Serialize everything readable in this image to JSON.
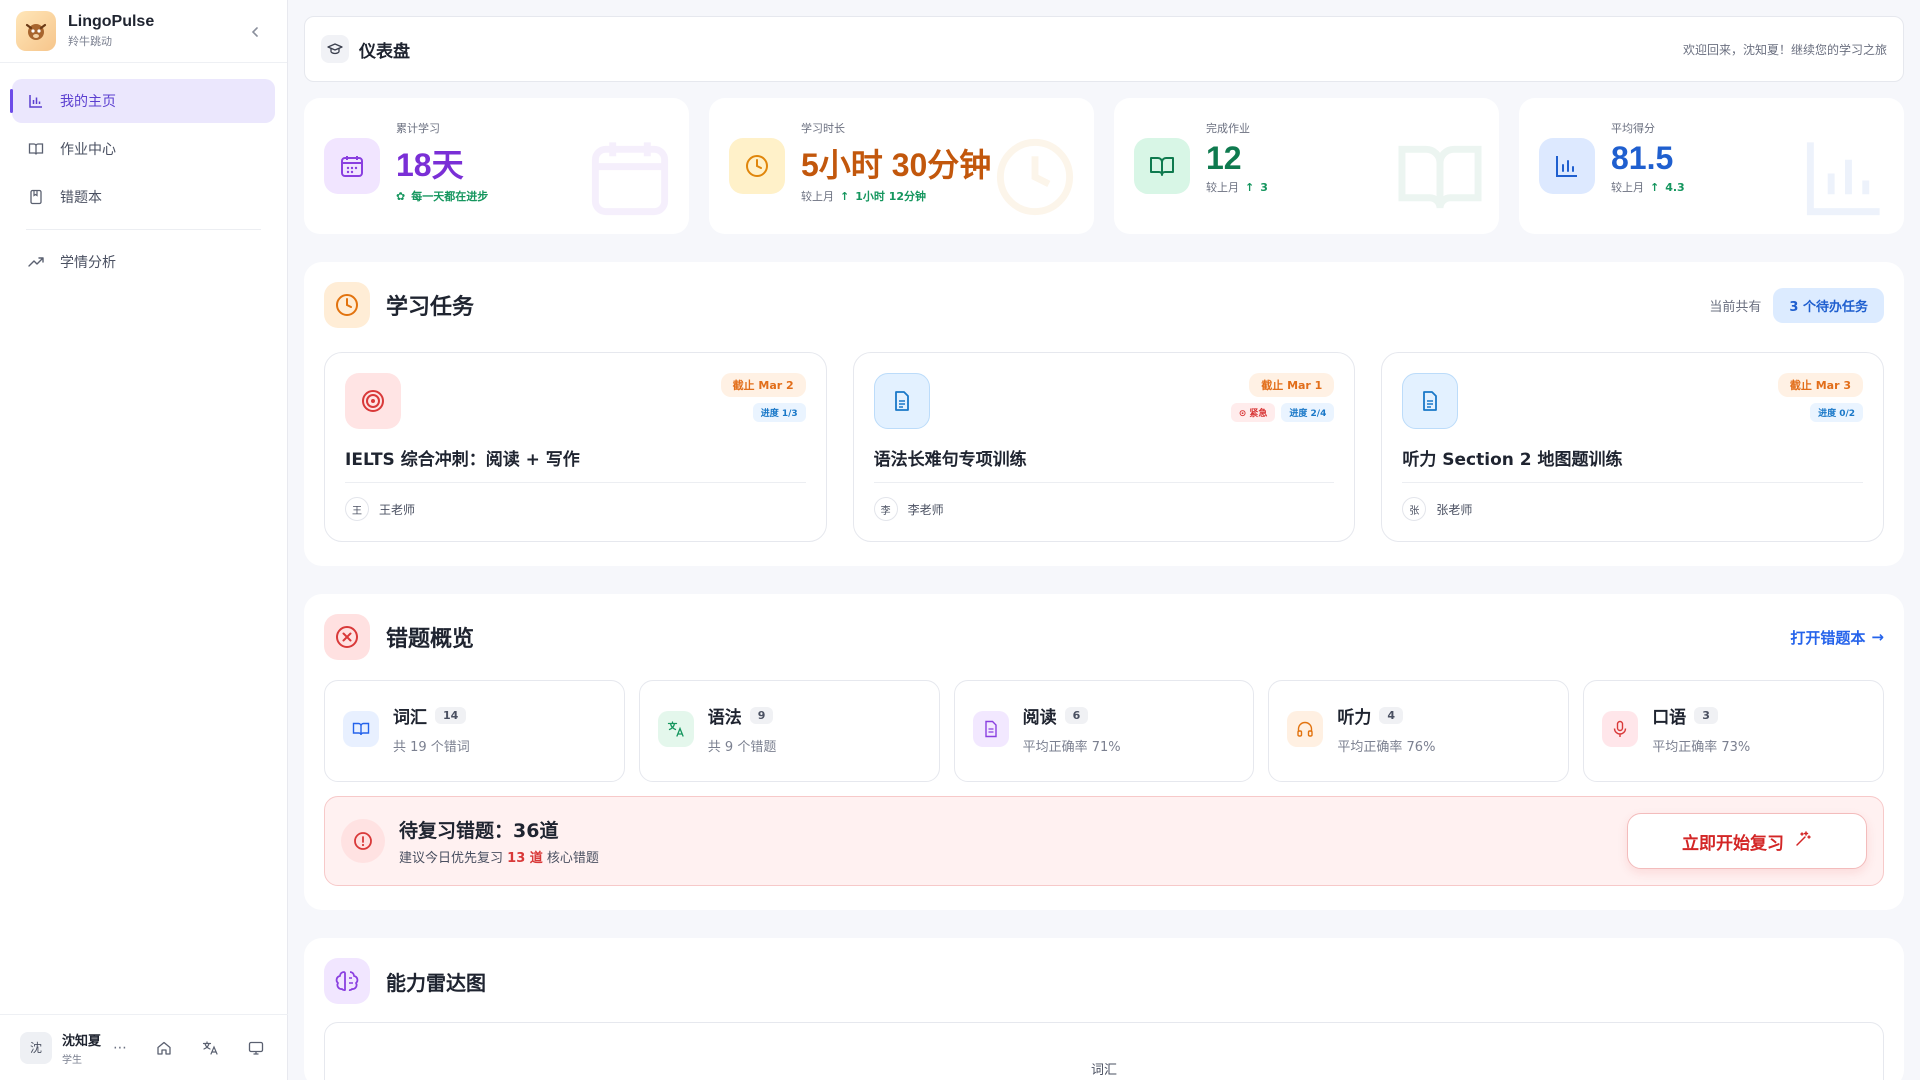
{
  "brand": {
    "name": "LingoPulse",
    "sub": "羚牛跳动"
  },
  "nav": [
    {
      "label": "我的主页",
      "icon": "bar-chart-icon",
      "active": true
    },
    {
      "label": "作业中心",
      "icon": "book-open-icon"
    },
    {
      "label": "错题本",
      "icon": "notebook-icon"
    },
    {
      "label": "学情分析",
      "icon": "trending-up-icon"
    }
  ],
  "user": {
    "name": "沈知夏",
    "role": "学生",
    "avatar": "沈"
  },
  "topbar": {
    "title": "仪表盘",
    "welcome": "欢迎回来，沈知夏！继续您的学习之旅"
  },
  "stats": [
    {
      "label": "累计学习",
      "value": "18天",
      "sub": "每一天都在进步",
      "color": "#7a2fd6",
      "icon": "calendar-icon"
    },
    {
      "label": "学习时长",
      "value": "5小时 30分钟",
      "sub_prefix": "较上月",
      "sub": "1小时 12分钟",
      "color": "#c2570c",
      "icon": "clock-icon"
    },
    {
      "label": "完成作业",
      "value": "12",
      "sub_prefix": "较上月",
      "sub": "3",
      "color": "#0f7a4f",
      "icon": "book-open-icon"
    },
    {
      "label": "平均得分",
      "value": "81.5",
      "sub_prefix": "较上月",
      "sub": "4.3",
      "color": "#1f5fcf",
      "icon": "bar-chart-icon"
    }
  ],
  "tasks_section": {
    "title": "学习任务",
    "count_prefix": "当前共有",
    "count_badge": "3 个待办任务",
    "tasks": [
      {
        "title": "IELTS 综合冲刺：阅读 + 写作",
        "deadline": "截止 Mar 2",
        "progress": "进度 1/3",
        "urgent": "",
        "teacher": "王老师",
        "teacher_avatar": "王",
        "icon": "target-icon"
      },
      {
        "title": "语法长难句专项训练",
        "deadline": "截止 Mar 1",
        "progress": "进度 2/4",
        "urgent": "紧急",
        "teacher": "李老师",
        "teacher_avatar": "李",
        "icon": "document-icon"
      },
      {
        "title": "听力 Section 2 地图题训练",
        "deadline": "截止 Mar 3",
        "progress": "进度 0/2",
        "urgent": "",
        "teacher": "张老师",
        "teacher_avatar": "张",
        "icon": "document-icon"
      }
    ]
  },
  "mistakes": {
    "title": "错题概览",
    "open_link": "打开错题本",
    "categories": [
      {
        "name": "词汇",
        "count": "14",
        "desc": "共 19 个错词",
        "icon": "book-icon"
      },
      {
        "name": "语法",
        "count": "9",
        "desc": "共 9 个错题",
        "icon": "translate-icon"
      },
      {
        "name": "阅读",
        "count": "6",
        "desc": "平均正确率 71%",
        "icon": "file-icon"
      },
      {
        "name": "听力",
        "count": "4",
        "desc": "平均正确率 76%",
        "icon": "headphones-icon"
      },
      {
        "name": "口语",
        "count": "3",
        "desc": "平均正确率 73%",
        "icon": "mic-icon"
      }
    ],
    "review": {
      "title": "待复习错题：36道",
      "desc_prefix": "建议今日优先复习",
      "desc_num": "13 道",
      "desc_suffix": "核心错题",
      "button": "立即开始复习"
    }
  },
  "radar": {
    "title": "能力雷达图",
    "label": "词汇"
  }
}
